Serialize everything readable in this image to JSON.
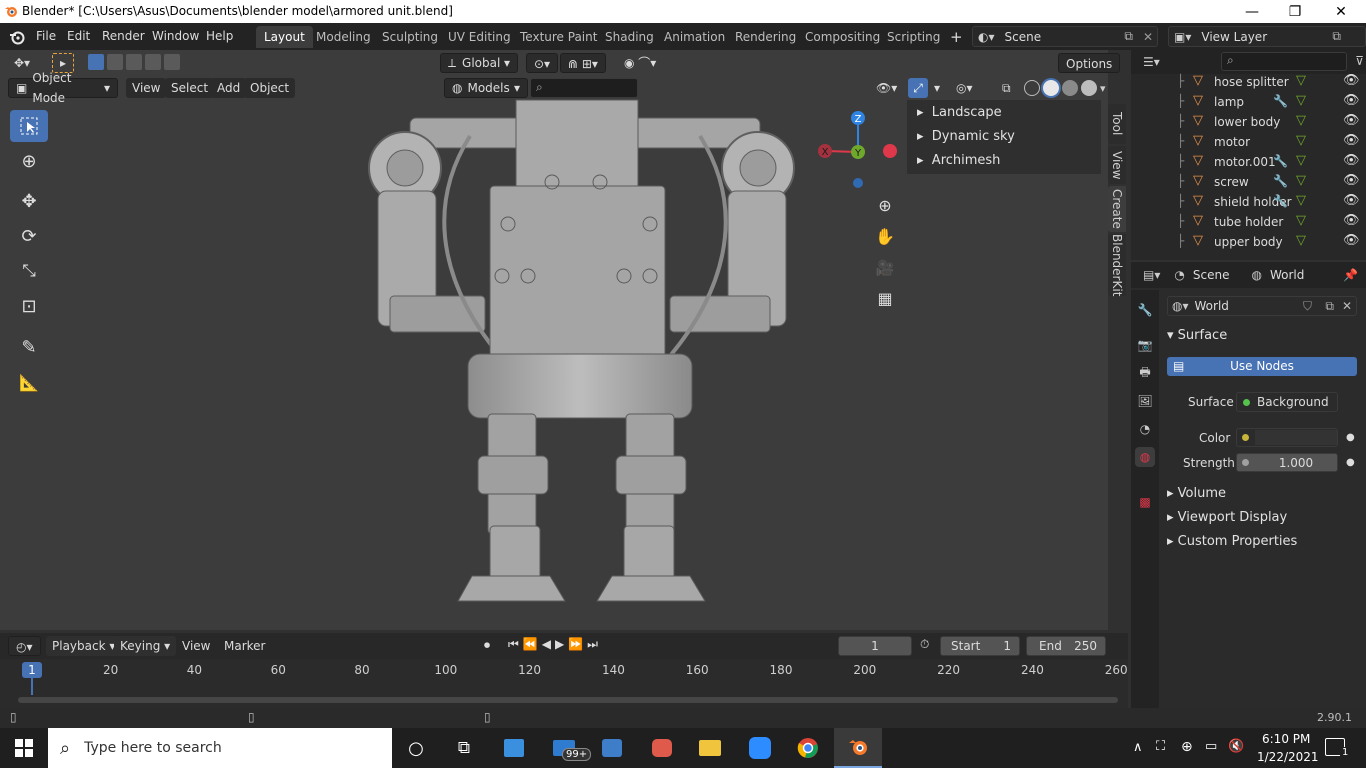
{
  "window": {
    "title": "Blender* [C:\\Users\\Asus\\Documents\\blender model\\armored unit.blend]",
    "minimize_glyph": "—",
    "maximize_glyph": "❐",
    "close_glyph": "✕"
  },
  "menu": [
    "File",
    "Edit",
    "Render",
    "Window",
    "Help"
  ],
  "workspaces": {
    "tabs": [
      "Layout",
      "Modeling",
      "Sculpting",
      "UV Editing",
      "Texture Paint",
      "Shading",
      "Animation",
      "Rendering",
      "Compositing",
      "Scripting"
    ],
    "active": "Layout",
    "add_glyph": "+"
  },
  "scene_selector": {
    "value": "Scene"
  },
  "view_layer_selector": {
    "value": "View Layer"
  },
  "viewport": {
    "transform_orientation": "Global",
    "options_label": "Options",
    "mode": "Object Mode",
    "menus": [
      "View",
      "Select",
      "Add",
      "Object"
    ],
    "collection_filter": "Models",
    "sidebar_tabs": [
      "Tool",
      "View",
      "Create",
      "BlenderKit"
    ],
    "npanel_items": [
      "Landscape",
      "Dynamic sky",
      "Archimesh"
    ],
    "gizmo": {
      "x": "X",
      "y": "Y",
      "z": "Z"
    }
  },
  "outliner": {
    "items": [
      {
        "name": "hose splitter",
        "modifier": false
      },
      {
        "name": "lamp",
        "modifier": true
      },
      {
        "name": "lower body",
        "modifier": false
      },
      {
        "name": "motor",
        "modifier": false
      },
      {
        "name": "motor.001",
        "modifier": true
      },
      {
        "name": "screw",
        "modifier": true
      },
      {
        "name": "shield holder",
        "modifier": true
      },
      {
        "name": "tube holder",
        "modifier": false
      },
      {
        "name": "upper body",
        "modifier": false
      }
    ]
  },
  "properties": {
    "breadcrumb_scene": "Scene",
    "breadcrumb_world": "World",
    "world_name": "World",
    "surface_section": "Surface",
    "use_nodes_label": "Use Nodes",
    "surface_label": "Surface",
    "surface_value": "Background",
    "color_label": "Color",
    "strength_label": "Strength",
    "strength_value": "1.000",
    "collapsed_sections": [
      "Volume",
      "Viewport Display",
      "Custom Properties"
    ]
  },
  "timeline": {
    "menus": [
      "Playback",
      "Keying",
      "View",
      "Marker"
    ],
    "current_frame": "1",
    "start_label": "Start",
    "start_value": "1",
    "end_label": "End",
    "end_value": "250",
    "ruler": [
      "20",
      "40",
      "60",
      "80",
      "100",
      "120",
      "140",
      "160",
      "180",
      "200",
      "220",
      "240",
      "260"
    ],
    "playhead": "1"
  },
  "status": {
    "version": "2.90.1"
  },
  "taskbar": {
    "search_placeholder": "Type here to search",
    "mail_badge": "99+",
    "time": "6:10 PM",
    "date": "1/22/2021",
    "notification_count": "1"
  },
  "colors": {
    "accent_blue": "#4772b3",
    "active_tool": "#5680c2",
    "mesh_icon": "#e5924a",
    "modifier_icon": "#6d9ad8",
    "axis_x": "#e0384b",
    "axis_y": "#6ea92c",
    "axis_z": "#2f83e2"
  }
}
